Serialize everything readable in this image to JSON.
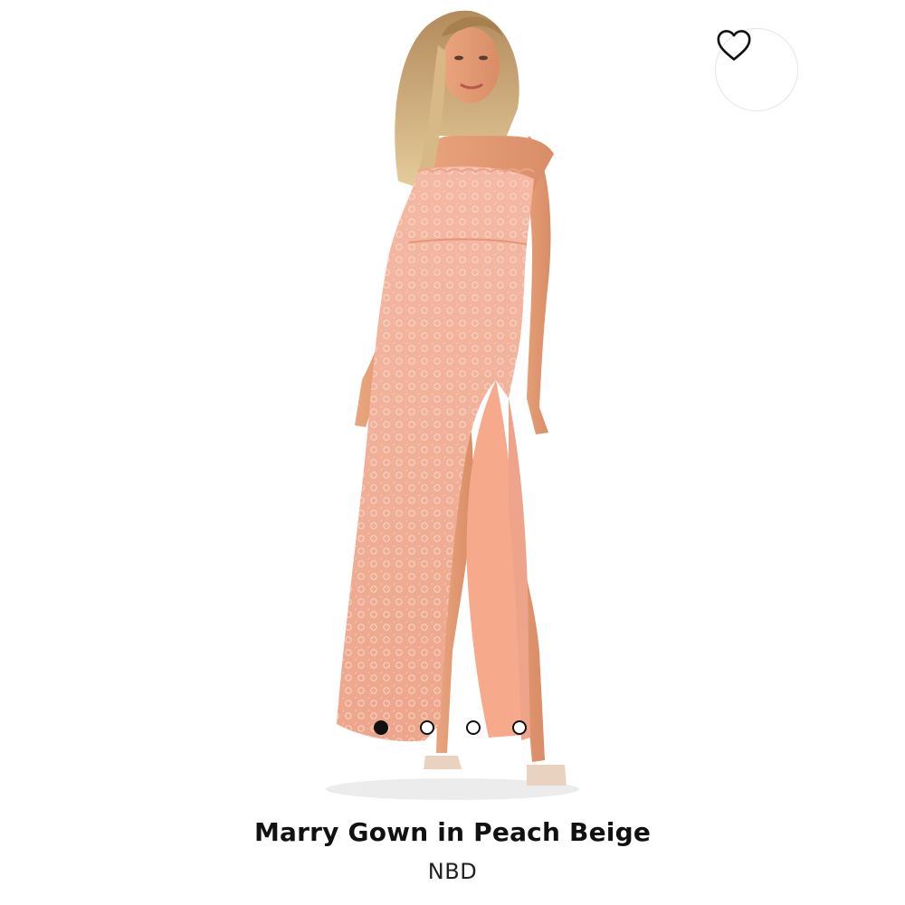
{
  "product": {
    "title": "Marry Gown in Peach Beige",
    "brand": "NBD"
  },
  "gallery": {
    "image_count": 4,
    "active_index": 0,
    "accent_color": "#111111",
    "dress_color": "#f1a98e"
  },
  "favorite": {
    "icon": "heart-outline-icon"
  }
}
